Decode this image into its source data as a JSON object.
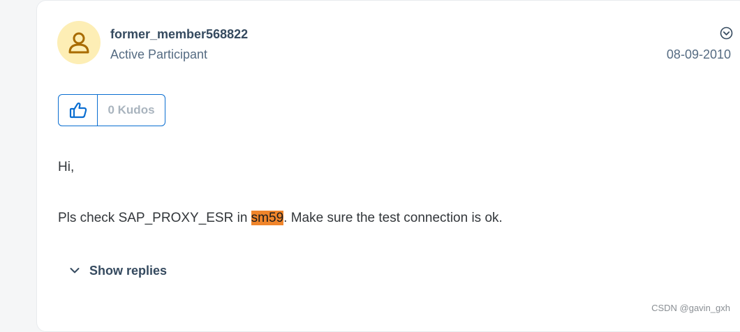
{
  "post": {
    "author_name": "former_member568822",
    "author_rank": "Active Participant",
    "date": "08-09-2010",
    "kudos_label": "0 Kudos",
    "greeting": "Hi,",
    "body_before": "Pls check SAP_PROXY_ESR in ",
    "body_highlight": "sm59",
    "body_after": ". Make sure the test connection is ok.",
    "show_replies_label": "Show replies"
  },
  "icons": {
    "avatar": "user-icon",
    "menu": "chevron-down-circle-icon",
    "kudos": "thumbs-up-icon",
    "replies": "chevron-down-icon"
  },
  "colors": {
    "accent": "#0a6ed1",
    "avatar_bg": "#fdeeb5",
    "avatar_fg": "#a86b00",
    "highlight": "#f0852b"
  },
  "watermark": "CSDN @gavin_gxh"
}
